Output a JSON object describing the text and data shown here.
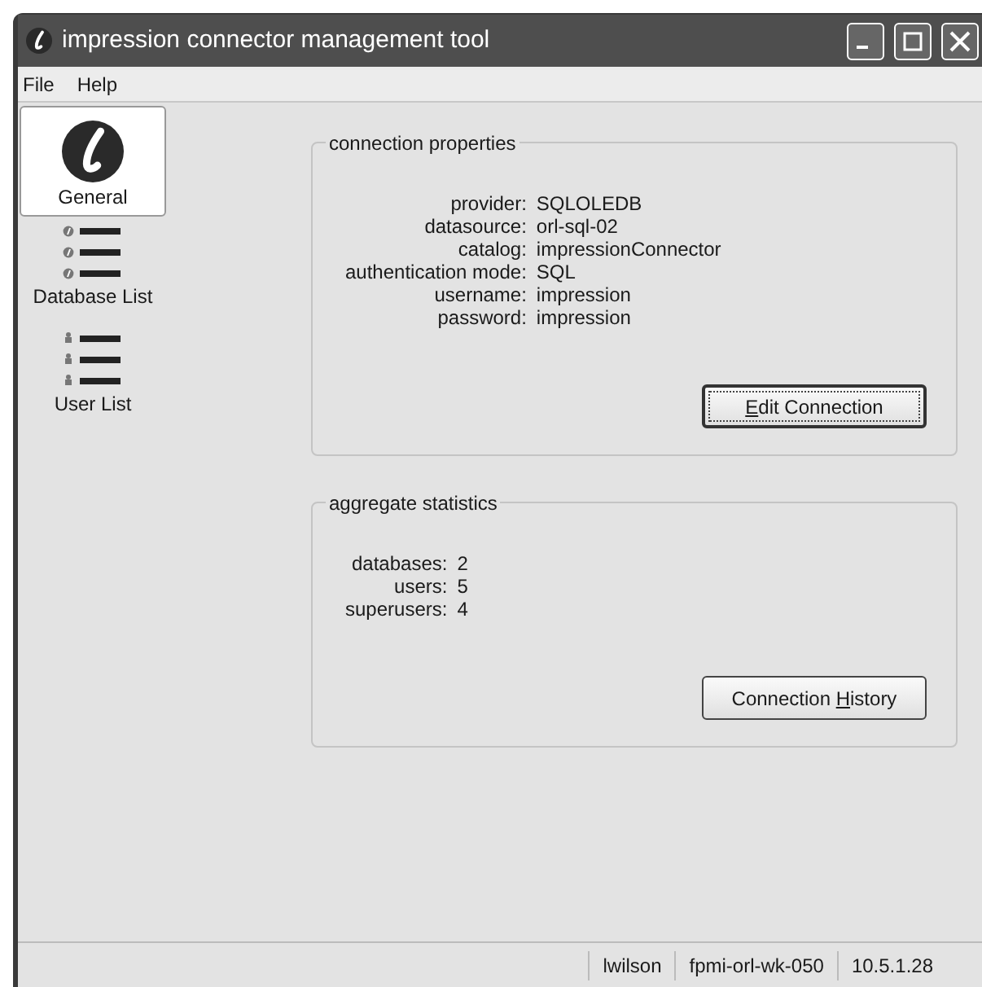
{
  "window": {
    "title": "impression connector management tool"
  },
  "menu": [
    "File",
    "Help"
  ],
  "sidebar": {
    "items": [
      {
        "kind": "logo",
        "label": "General",
        "selected": true
      },
      {
        "kind": "databases",
        "label": "Database List",
        "selected": false
      },
      {
        "kind": "users",
        "label": "User List",
        "selected": false
      }
    ]
  },
  "groups": [
    {
      "title": "connection properties",
      "fields": [
        {
          "label": "provider:",
          "value": "SQLOLEDB"
        },
        {
          "label": "datasource:",
          "value": "orl-sql-02"
        },
        {
          "label": "catalog:",
          "value": "impressionConnector"
        },
        {
          "label": "authentication mode:",
          "value": "SQL"
        },
        {
          "label": "username:",
          "value": "impression"
        },
        {
          "label": "password:",
          "value": "impression"
        }
      ],
      "button": {
        "mnemonic": "E",
        "after": "dit Connection",
        "focused": true
      }
    },
    {
      "title": "aggregate statistics",
      "fields": [
        {
          "label": "databases:",
          "value": "2"
        },
        {
          "label": "users:",
          "value": "5"
        },
        {
          "label": "superusers:",
          "value": "4"
        }
      ],
      "button": {
        "before": "Connection ",
        "mnemonic": "H",
        "after": "istory",
        "focused": false
      }
    }
  ],
  "status_bar": [
    "lwilson",
    "fpmi-orl-wk-050",
    "10.5.1.28"
  ]
}
